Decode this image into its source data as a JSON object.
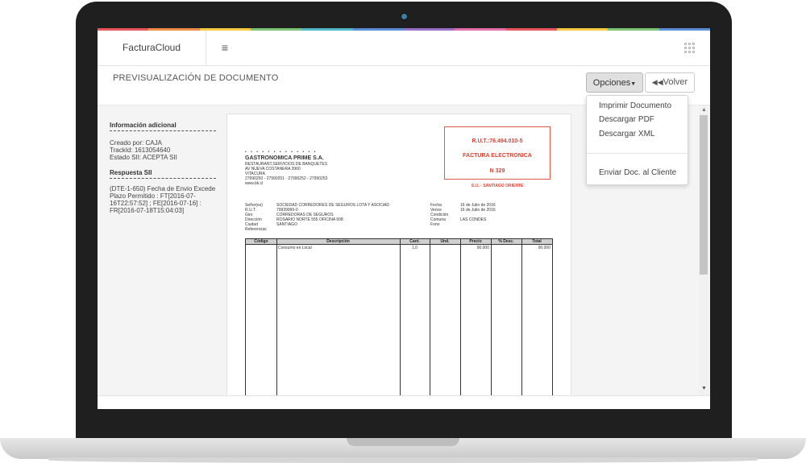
{
  "app": {
    "brand": "FacturaCloud"
  },
  "page": {
    "title": "PREVISUALIZACIÓN DE DOCUMENTO"
  },
  "toolbar": {
    "opciones_label": "Opciones",
    "volver_label": "Volver"
  },
  "dropdown": {
    "items": [
      "Imprimir Documento",
      "Descargar PDF",
      "Descargar XML",
      "Enviar Doc. al Cliente"
    ]
  },
  "sidebar": {
    "info_heading": "Información adicional",
    "created_by": "Creado por: CAJA",
    "trackid": "TrackId: 1613054640",
    "estado": "Estado SII: ACEPTA SII",
    "sii_heading": "Respuesta SII",
    "sii_lines": [
      "(DTE-1-650) Fecha de Envio Excede",
      "Plazo Permitido : FT[2016-07-",
      "16T22:57:52] ; FE[2016-07-16] :",
      "FR[2016-07-18T15:04:03]"
    ]
  },
  "invoice": {
    "brand_stamp": "• • • • •  • • • • • • • •",
    "company": "GASTRONOMICA PRIME S.A.",
    "giro": "RESTAURANT,SERVICIOS DE BANQUETES",
    "address": "AV NUEVA COSTANERA 3960",
    "commune": "VITACURA",
    "phones": "27990250 - 27990251 - 27990252 - 27990253",
    "web": "www.bk.cl",
    "rut": "R.U.T.:76.494.010-5",
    "doc_type": "FACTURA ELECTRONICA",
    "number": "N 329",
    "sii_office": "S.I.I. - SANTIAGO ORIENTE",
    "client_labels": [
      "Señor(es)",
      "R.U.T.",
      "Giro",
      "Dirección",
      "Ciudad",
      "Referencias"
    ],
    "client_values": [
      "SOCIEDAD CORREDORES DE SEGUROS LOTA Y ASOCIAD",
      "79939990-0",
      "CORREDORAS DE SEGUROS",
      "ROSARIO NORTE 555 OFICINA 608",
      "SANTIAGO",
      ""
    ],
    "meta_labels": [
      "Fecha",
      "Vence",
      "Condición",
      "Comuna",
      "Fono"
    ],
    "meta_values": [
      "16 de Julio de 2016",
      "16 de Julio de 2016",
      "",
      "LAS CONDES",
      ""
    ],
    "table_headers": [
      "Código",
      "Descripción",
      "Cant.",
      "Und.",
      "Precio",
      "% Desc.",
      "Total"
    ],
    "rows": [
      {
        "codigo": "",
        "descripcion": "Consumo en Local",
        "cant": "1,0",
        "und": "",
        "precio": "90.000",
        "desc": "",
        "total": "90.000"
      }
    ]
  },
  "colors": {
    "accent_red": "#e0402e",
    "rainbow": [
      "#e8555a",
      "#f08c4a",
      "#f5c842",
      "#7cc576",
      "#4fb7c5",
      "#5b8ed6",
      "#9b6fc8",
      "#e46fa8",
      "#e8555a",
      "#f5c842",
      "#7cc576",
      "#5b8ed6"
    ]
  },
  "icons": {
    "menu": "hamburger-icon",
    "apps": "grid-dots-icon",
    "back": "double-chevron-left-icon",
    "caret": "caret-down-icon"
  }
}
